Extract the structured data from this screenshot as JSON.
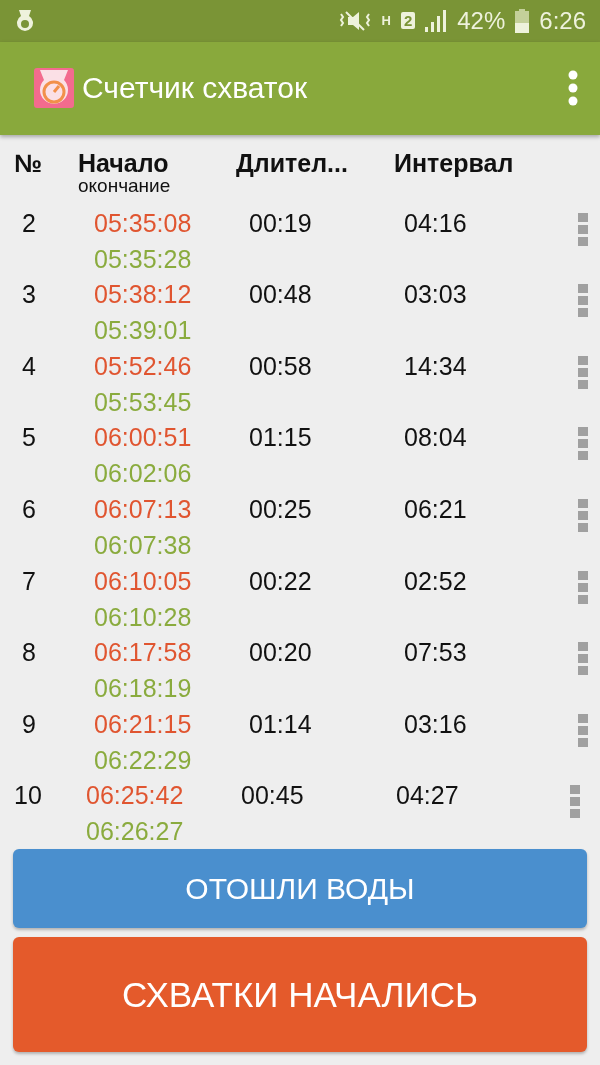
{
  "status_bar": {
    "network": "H",
    "sim": "2",
    "battery": "42%",
    "time": "6:26"
  },
  "app_bar": {
    "title": "Счетчик схваток"
  },
  "table": {
    "columns": {
      "number": "№",
      "start": "Начало",
      "end": "окончание",
      "duration": "Длител...",
      "interval": "Интервал"
    },
    "rows": [
      {
        "number": "2",
        "start": "05:35:08",
        "end": "05:35:28",
        "duration": "00:19",
        "interval": "04:16"
      },
      {
        "number": "3",
        "start": "05:38:12",
        "end": "05:39:01",
        "duration": "00:48",
        "interval": "03:03"
      },
      {
        "number": "4",
        "start": "05:52:46",
        "end": "05:53:45",
        "duration": "00:58",
        "interval": "14:34"
      },
      {
        "number": "5",
        "start": "06:00:51",
        "end": "06:02:06",
        "duration": "01:15",
        "interval": "08:04"
      },
      {
        "number": "6",
        "start": "06:07:13",
        "end": "06:07:38",
        "duration": "00:25",
        "interval": "06:21"
      },
      {
        "number": "7",
        "start": "06:10:05",
        "end": "06:10:28",
        "duration": "00:22",
        "interval": "02:52"
      },
      {
        "number": "8",
        "start": "06:17:58",
        "end": "06:18:19",
        "duration": "00:20",
        "interval": "07:53"
      },
      {
        "number": "9",
        "start": "06:21:15",
        "end": "06:22:29",
        "duration": "01:14",
        "interval": "03:16"
      },
      {
        "number": "10",
        "start": "06:25:42",
        "end": "06:26:27",
        "duration": "00:45",
        "interval": "04:27"
      }
    ]
  },
  "buttons": [
    {
      "label": "ОТОШЛИ ВОДЫ",
      "kind": "water"
    },
    {
      "label": "СХВАТКИ НАЧАЛИСЬ",
      "kind": "contractions"
    }
  ]
}
